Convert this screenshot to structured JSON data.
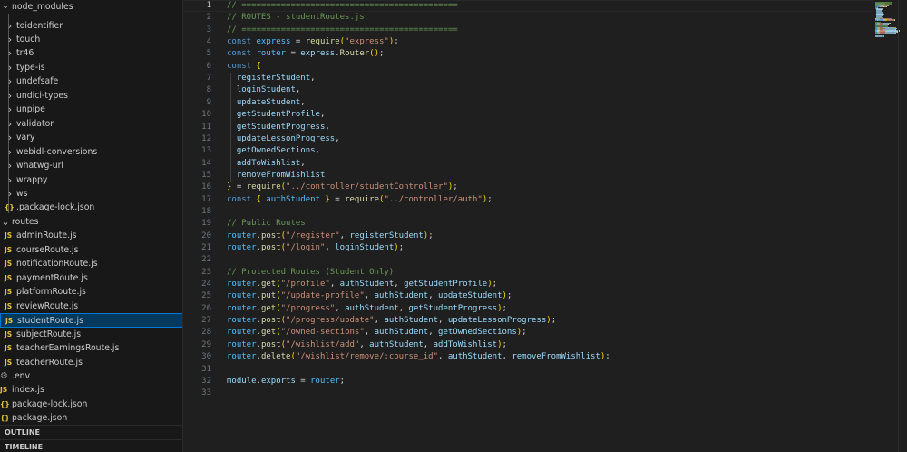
{
  "sidebar": {
    "root": "node_modules",
    "items": [
      {
        "label": "toidentifier",
        "kind": "folder"
      },
      {
        "label": "touch",
        "kind": "folder"
      },
      {
        "label": "tr46",
        "kind": "folder"
      },
      {
        "label": "type-is",
        "kind": "folder"
      },
      {
        "label": "undefsafe",
        "kind": "folder"
      },
      {
        "label": "undici-types",
        "kind": "folder"
      },
      {
        "label": "unpipe",
        "kind": "folder"
      },
      {
        "label": "validator",
        "kind": "folder"
      },
      {
        "label": "vary",
        "kind": "folder"
      },
      {
        "label": "webidl-conversions",
        "kind": "folder"
      },
      {
        "label": "whatwg-url",
        "kind": "folder"
      },
      {
        "label": "wrappy",
        "kind": "folder"
      },
      {
        "label": "ws",
        "kind": "folder"
      },
      {
        "label": ".package-lock.json",
        "kind": "json"
      }
    ],
    "routes_folder": "routes",
    "routes": [
      {
        "label": "adminRoute.js"
      },
      {
        "label": "courseRoute.js"
      },
      {
        "label": "notificationRoute.js"
      },
      {
        "label": "paymentRoute.js"
      },
      {
        "label": "platformRoute.js"
      },
      {
        "label": "reviewRoute.js"
      },
      {
        "label": "studentRoute.js",
        "selected": true
      },
      {
        "label": "subjectRoute.js"
      },
      {
        "label": "teacherEarningsRoute.js"
      },
      {
        "label": "teacherRoute.js"
      }
    ],
    "root_files": [
      {
        "label": ".env",
        "kind": "env"
      },
      {
        "label": "index.js",
        "kind": "js"
      },
      {
        "label": "package-lock.json",
        "kind": "json"
      },
      {
        "label": "package.json",
        "kind": "json"
      }
    ],
    "js_badge": "JS",
    "json_badge": "{}",
    "outline": "OUTLINE",
    "timeline": "TIMELINE"
  },
  "editor": {
    "current_line": 1,
    "lines": [
      [
        [
          "c",
          "// ============================================"
        ]
      ],
      [
        [
          "c",
          "// ROUTES - studentRoutes.js"
        ]
      ],
      [
        [
          "c",
          "// ============================================"
        ]
      ],
      [
        [
          "k",
          "const "
        ],
        [
          "vc",
          "express"
        ],
        [
          "p",
          " = "
        ],
        [
          "f",
          "require"
        ],
        [
          "b1",
          "("
        ],
        [
          "s",
          "\"express\""
        ],
        [
          "b1",
          ")"
        ],
        [
          "p",
          ";"
        ]
      ],
      [
        [
          "k",
          "const "
        ],
        [
          "vc",
          "router"
        ],
        [
          "p",
          " = "
        ],
        [
          "v",
          "express"
        ],
        [
          "p",
          "."
        ],
        [
          "f",
          "Router"
        ],
        [
          "b1",
          "()"
        ],
        [
          "p",
          ";"
        ]
      ],
      [
        [
          "k",
          "const "
        ],
        [
          "b1",
          "{"
        ]
      ],
      [
        [
          "p",
          "  "
        ],
        [
          "v",
          "registerStudent"
        ],
        [
          "p",
          ","
        ]
      ],
      [
        [
          "p",
          "  "
        ],
        [
          "v",
          "loginStudent"
        ],
        [
          "p",
          ","
        ]
      ],
      [
        [
          "p",
          "  "
        ],
        [
          "v",
          "updateStudent"
        ],
        [
          "p",
          ","
        ]
      ],
      [
        [
          "p",
          "  "
        ],
        [
          "v",
          "getStudentProfile"
        ],
        [
          "p",
          ","
        ]
      ],
      [
        [
          "p",
          "  "
        ],
        [
          "v",
          "getStudentProgress"
        ],
        [
          "p",
          ","
        ]
      ],
      [
        [
          "p",
          "  "
        ],
        [
          "v",
          "updateLessonProgress"
        ],
        [
          "p",
          ","
        ]
      ],
      [
        [
          "p",
          "  "
        ],
        [
          "v",
          "getOwnedSections"
        ],
        [
          "p",
          ","
        ]
      ],
      [
        [
          "p",
          "  "
        ],
        [
          "v",
          "addToWishlist"
        ],
        [
          "p",
          ","
        ]
      ],
      [
        [
          "p",
          "  "
        ],
        [
          "v",
          "removeFromWishlist"
        ]
      ],
      [
        [
          "b1",
          "}"
        ],
        [
          "p",
          " = "
        ],
        [
          "f",
          "require"
        ],
        [
          "b1",
          "("
        ],
        [
          "s",
          "\"../controller/studentController\""
        ],
        [
          "b1",
          ")"
        ],
        [
          "p",
          ";"
        ]
      ],
      [
        [
          "k",
          "const "
        ],
        [
          "b1",
          "{ "
        ],
        [
          "vc",
          "authStudent"
        ],
        [
          "b1",
          " }"
        ],
        [
          "p",
          " = "
        ],
        [
          "f",
          "require"
        ],
        [
          "b1",
          "("
        ],
        [
          "s",
          "\"../controller/auth\""
        ],
        [
          "b1",
          ")"
        ],
        [
          "p",
          ";"
        ]
      ],
      [],
      [
        [
          "c",
          "// Public Routes"
        ]
      ],
      [
        [
          "vc",
          "router"
        ],
        [
          "p",
          "."
        ],
        [
          "f",
          "post"
        ],
        [
          "b1",
          "("
        ],
        [
          "s",
          "\"/register\""
        ],
        [
          "p",
          ", "
        ],
        [
          "v",
          "registerStudent"
        ],
        [
          "b1",
          ")"
        ],
        [
          "p",
          ";"
        ]
      ],
      [
        [
          "vc",
          "router"
        ],
        [
          "p",
          "."
        ],
        [
          "f",
          "post"
        ],
        [
          "b1",
          "("
        ],
        [
          "s",
          "\"/login\""
        ],
        [
          "p",
          ", "
        ],
        [
          "v",
          "loginStudent"
        ],
        [
          "b1",
          ")"
        ],
        [
          "p",
          ";"
        ]
      ],
      [],
      [
        [
          "c",
          "// Protected Routes (Student Only)"
        ]
      ],
      [
        [
          "vc",
          "router"
        ],
        [
          "p",
          "."
        ],
        [
          "f",
          "get"
        ],
        [
          "b1",
          "("
        ],
        [
          "s",
          "\"/profile\""
        ],
        [
          "p",
          ", "
        ],
        [
          "v",
          "authStudent"
        ],
        [
          "p",
          ", "
        ],
        [
          "v",
          "getStudentProfile"
        ],
        [
          "b1",
          ")"
        ],
        [
          "p",
          ";"
        ]
      ],
      [
        [
          "vc",
          "router"
        ],
        [
          "p",
          "."
        ],
        [
          "f",
          "put"
        ],
        [
          "b1",
          "("
        ],
        [
          "s",
          "\"/update-profile\""
        ],
        [
          "p",
          ", "
        ],
        [
          "v",
          "authStudent"
        ],
        [
          "p",
          ", "
        ],
        [
          "v",
          "updateStudent"
        ],
        [
          "b1",
          ")"
        ],
        [
          "p",
          ";"
        ]
      ],
      [
        [
          "vc",
          "router"
        ],
        [
          "p",
          "."
        ],
        [
          "f",
          "get"
        ],
        [
          "b1",
          "("
        ],
        [
          "s",
          "\"/progress\""
        ],
        [
          "p",
          ", "
        ],
        [
          "v",
          "authStudent"
        ],
        [
          "p",
          ", "
        ],
        [
          "v",
          "getStudentProgress"
        ],
        [
          "b1",
          ")"
        ],
        [
          "p",
          ";"
        ]
      ],
      [
        [
          "vc",
          "router"
        ],
        [
          "p",
          "."
        ],
        [
          "f",
          "post"
        ],
        [
          "b1",
          "("
        ],
        [
          "s",
          "\"/progress/update\""
        ],
        [
          "p",
          ", "
        ],
        [
          "v",
          "authStudent"
        ],
        [
          "p",
          ", "
        ],
        [
          "v",
          "updateLessonProgress"
        ],
        [
          "b1",
          ")"
        ],
        [
          "p",
          ";"
        ]
      ],
      [
        [
          "vc",
          "router"
        ],
        [
          "p",
          "."
        ],
        [
          "f",
          "get"
        ],
        [
          "b1",
          "("
        ],
        [
          "s",
          "\"/owned-sections\""
        ],
        [
          "p",
          ", "
        ],
        [
          "v",
          "authStudent"
        ],
        [
          "p",
          ", "
        ],
        [
          "v",
          "getOwnedSections"
        ],
        [
          "b1",
          ")"
        ],
        [
          "p",
          ";"
        ]
      ],
      [
        [
          "vc",
          "router"
        ],
        [
          "p",
          "."
        ],
        [
          "f",
          "post"
        ],
        [
          "b1",
          "("
        ],
        [
          "s",
          "\"/wishlist/add\""
        ],
        [
          "p",
          ", "
        ],
        [
          "v",
          "authStudent"
        ],
        [
          "p",
          ", "
        ],
        [
          "v",
          "addToWishlist"
        ],
        [
          "b1",
          ")"
        ],
        [
          "p",
          ";"
        ]
      ],
      [
        [
          "vc",
          "router"
        ],
        [
          "p",
          "."
        ],
        [
          "f",
          "delete"
        ],
        [
          "b1",
          "("
        ],
        [
          "s",
          "\"/wishlist/remove/:course_id\""
        ],
        [
          "p",
          ", "
        ],
        [
          "v",
          "authStudent"
        ],
        [
          "p",
          ", "
        ],
        [
          "v",
          "removeFromWishlist"
        ],
        [
          "b1",
          ")"
        ],
        [
          "p",
          ";"
        ]
      ],
      [],
      [
        [
          "v",
          "module"
        ],
        [
          "p",
          "."
        ],
        [
          "v",
          "exports"
        ],
        [
          "p",
          " = "
        ],
        [
          "vc",
          "router"
        ],
        [
          "p",
          ";"
        ]
      ],
      []
    ]
  }
}
